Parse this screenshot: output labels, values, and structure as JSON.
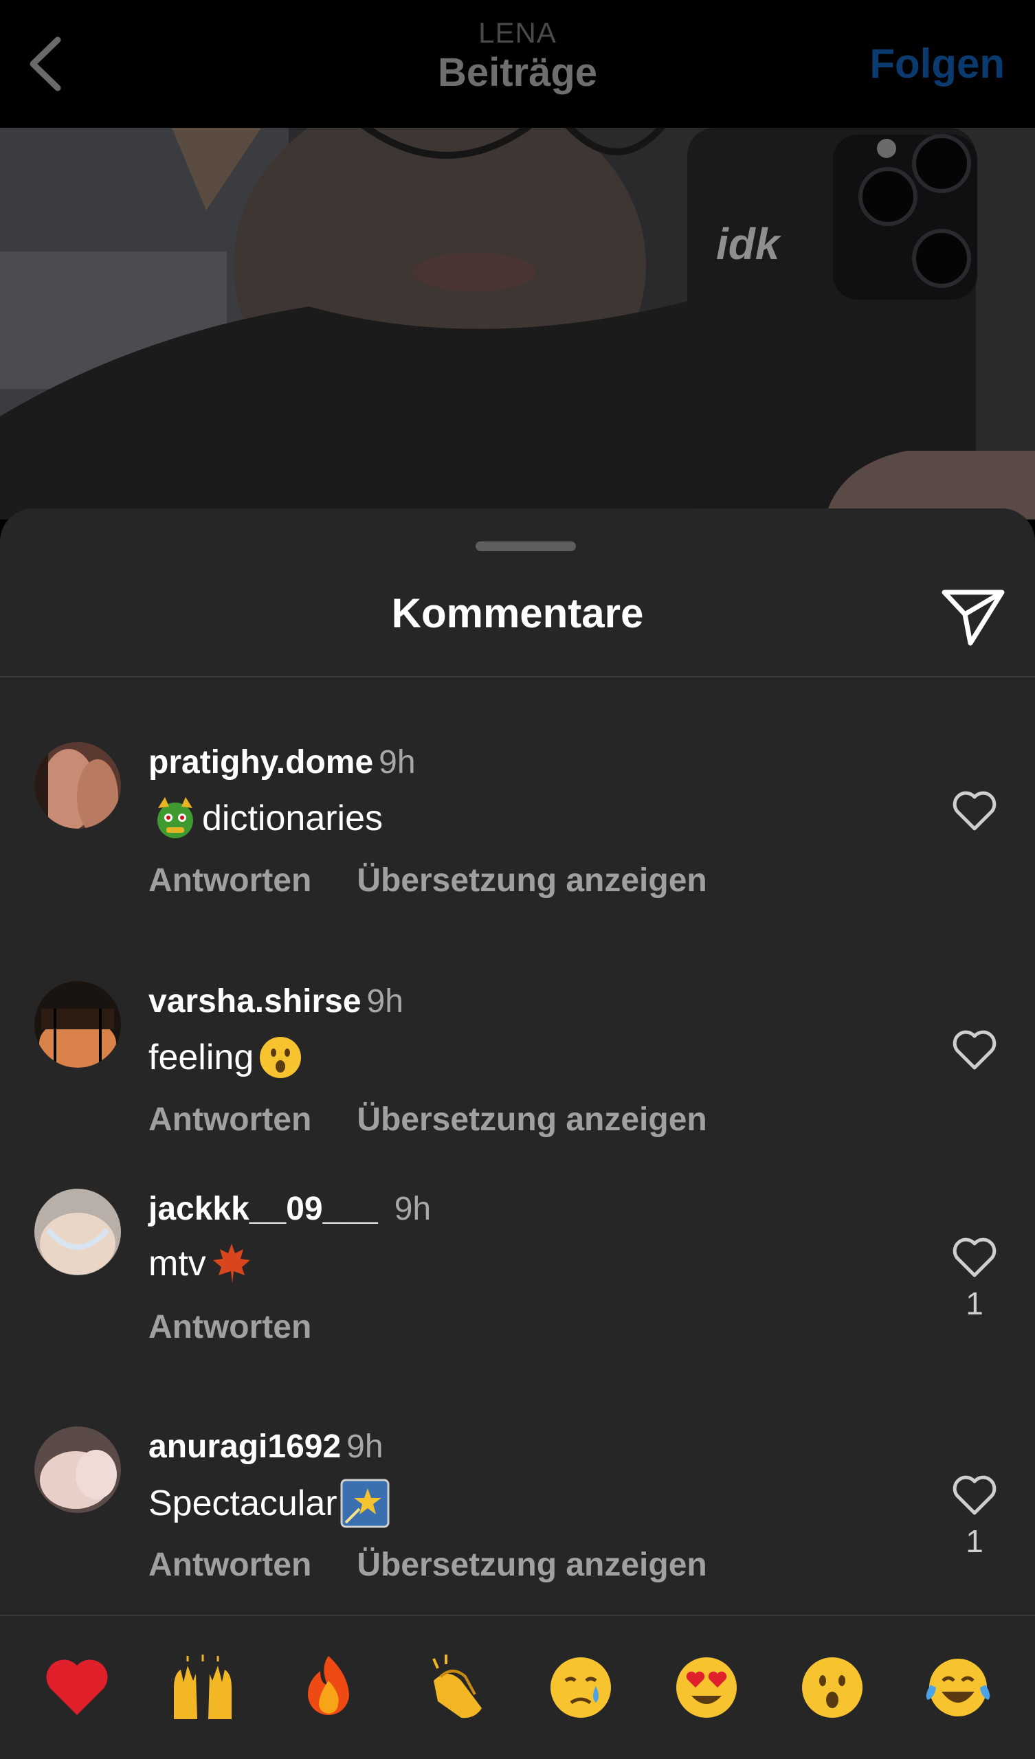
{
  "header": {
    "username": "LENA",
    "section_title": "Beiträge",
    "follow_label": "Folgen",
    "back_icon": "chevron-left-icon"
  },
  "post": {
    "overlay_text": "idk"
  },
  "comments_sheet": {
    "title": "Kommentare",
    "share_icon": "paper-plane-icon",
    "comments": [
      {
        "username": "pratighy.dome",
        "time": "9h",
        "text": "dictionaries",
        "text_emoji": "dragon-face-emoji",
        "reply_label": "Antworten",
        "translate_label": "Übersetzung anzeigen",
        "like_count": ""
      },
      {
        "username": "varsha.shirse",
        "time": "9h",
        "text": "feeling",
        "text_emoji": "hushed-face-emoji",
        "reply_label": "Antworten",
        "translate_label": "Übersetzung anzeigen",
        "like_count": ""
      },
      {
        "username": "jackkk__09___",
        "time": "9h",
        "text": "mtv",
        "text_emoji": "maple-leaf-emoji",
        "reply_label": "Antworten",
        "translate_label": "",
        "like_count": "1"
      },
      {
        "username": "anuragi1692",
        "time": "9h",
        "text": "Spectacular",
        "text_emoji": "shooting-star-emoji",
        "reply_label": "Antworten",
        "translate_label": "Übersetzung anzeigen",
        "like_count": "1"
      }
    ]
  },
  "emoji_bar": [
    "red-heart-emoji",
    "raising-hands-emoji",
    "fire-emoji",
    "clapping-hands-emoji",
    "crying-face-emoji",
    "heart-eyes-emoji",
    "hushed-face-emoji",
    "tears-of-joy-emoji"
  ],
  "colors": {
    "sheet_background": "#262626",
    "follow_text": "#0b3b6e",
    "secondary_text": "#a8a8a8"
  }
}
